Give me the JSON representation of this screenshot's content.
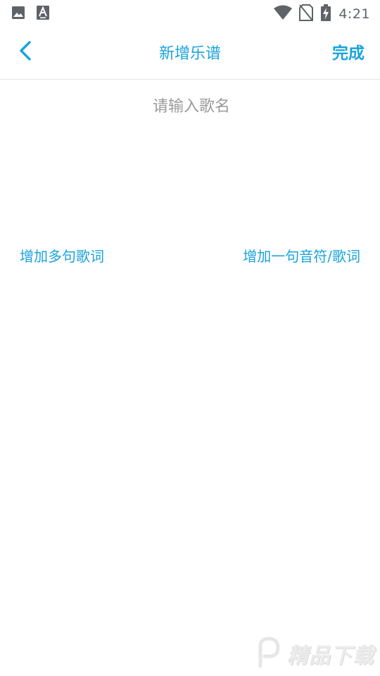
{
  "status_bar": {
    "time": "4:21",
    "left_icons": [
      "image-icon",
      "text-a-icon"
    ],
    "right_icons": [
      "wifi-icon",
      "no-sim-icon",
      "battery-charging-icon"
    ]
  },
  "nav": {
    "title": "新增乐谱",
    "done_label": "完成",
    "back_icon": "chevron-left-icon"
  },
  "song": {
    "value": "",
    "placeholder": "请输入歌名"
  },
  "actions": {
    "add_multi_lyrics": "增加多句歌词",
    "add_one_note_lyric": "增加一句音符/歌词"
  },
  "watermark": {
    "text": "精品下载"
  },
  "colors": {
    "accent": "#1aa3dc",
    "placeholder": "#9a9a9a",
    "status_icon": "#5f6368",
    "divider": "#e4e4e4"
  }
}
